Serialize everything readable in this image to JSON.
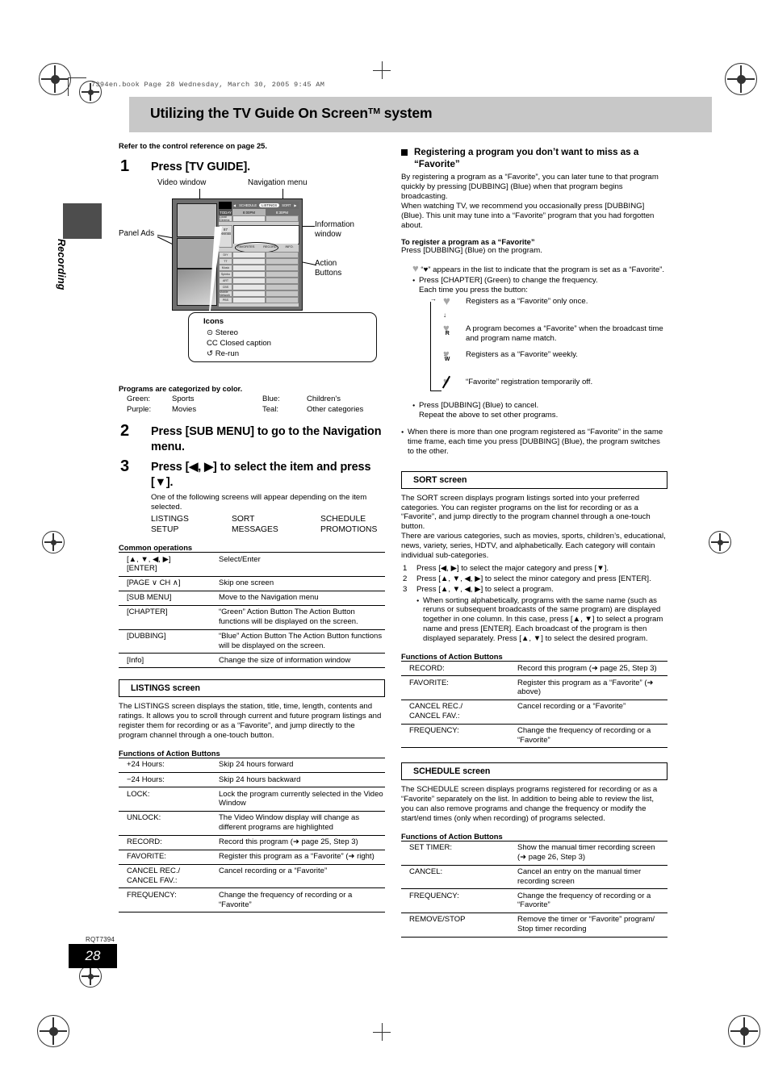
{
  "meta": {
    "running_head": "7394en.book  Page 28  Wednesday, March 30, 2005  9:45 AM",
    "side_tab": "Recording",
    "doc_code": "RQT7394",
    "page_number": "28"
  },
  "title": {
    "main": "Utilizing the TV Guide On Screen",
    "sup": "TM",
    "tail": " system"
  },
  "left": {
    "intro": "Refer to the control reference on page 25.",
    "step1": {
      "num": "1",
      "head": "Press [TV GUIDE]."
    },
    "diagram": {
      "label_video_window": "Video window",
      "label_navigation_menu": "Navigation menu",
      "label_panel_ads": "Panel Ads",
      "label_information_window": "Information\nwindow",
      "label_action_buttons": "Action\nButtons",
      "nav": {
        "left_arrow": "◀",
        "schedule": "SCHEDULE",
        "listings": "LISTINGS",
        "sort": "SORT",
        "right_arrow": "▶"
      },
      "time_header": {
        "channel": "TODAY",
        "slot1": "8:00PM",
        "slot2": "8:30PM"
      },
      "channel_cell": {
        "number": "87",
        "name": "NWSB"
      },
      "action_bar": [
        "FAVORITES",
        "RECORD",
        "INFO."
      ],
      "rows": [
        "Local Cinema",
        "DIY",
        "TT",
        "Music",
        "Spinbo",
        "ART",
        "CBS",
        "Mobile Network",
        "PBS"
      ],
      "icons_title": "Icons",
      "icons": [
        {
          "glyph": "⊙",
          "label": "Stereo"
        },
        {
          "glyph": "CC",
          "label": "Closed caption"
        },
        {
          "glyph": "↺",
          "label": "Re-run"
        }
      ]
    },
    "color_note": "Programs are categorized by color.",
    "color_table": [
      {
        "color": "Green:",
        "category": "Sports",
        "color2": "Blue:",
        "category2": "Children's"
      },
      {
        "color": "Purple:",
        "category": "Movies",
        "color2": "Teal:",
        "category2": "Other categories"
      }
    ],
    "step2": {
      "num": "2",
      "head": "Press [SUB MENU] to go to the Navigation menu."
    },
    "step3": {
      "num": "3",
      "head": "Press [◀, ▶] to select the item and press [▼].",
      "sub": "One of the following screens will appear depending on the item selected.",
      "screens": [
        "LISTINGS",
        "SORT",
        "SCHEDULE",
        "SETUP",
        "MESSAGES",
        "PROMOTIONS"
      ]
    },
    "common_ops_title": "Common operations",
    "common_ops": [
      {
        "key": "[▲, ▼, ◀, ▶]\n[ENTER]",
        "desc": "Select/Enter"
      },
      {
        "key": "[PAGE ∨ CH ∧]",
        "desc": "Skip one screen"
      },
      {
        "key": "[SUB MENU]",
        "desc": "Move to the Navigation menu"
      },
      {
        "key": "[CHAPTER]",
        "desc": "“Green” Action Button\nThe Action Button functions will be displayed on the screen."
      },
      {
        "key": "[DUBBING]",
        "desc": "“Blue” Action Button\nThe Action Button functions will be displayed on the screen."
      },
      {
        "key": "[Info]",
        "desc": "Change the size of information window"
      }
    ],
    "listings": {
      "title": "LISTINGS screen",
      "body": "The LISTINGS screen displays the station, title, time, length, contents and ratings. It allows you to scroll through current and future program listings and register them for recording or as a “Favorite”, and jump directly to the program channel through a one-touch button.",
      "functions_title": "Functions of Action Buttons",
      "functions": [
        {
          "key": "+24 Hours:",
          "desc": "Skip 24 hours forward"
        },
        {
          "key": "−24 Hours:",
          "desc": "Skip 24 hours backward"
        },
        {
          "key": "LOCK:",
          "desc": "Lock the program currently selected in the Video Window"
        },
        {
          "key": "UNLOCK:",
          "desc": "The Video Window display will change as different programs are highlighted"
        },
        {
          "key": "RECORD:",
          "desc": "Record this program (➜ page 25, Step 3)"
        },
        {
          "key": "FAVORITE:",
          "desc": "Register this program as a “Favorite” (➜ right)"
        },
        {
          "key": "CANCEL REC./\nCANCEL FAV.:",
          "desc": "Cancel recording or a “Favorite”"
        },
        {
          "key": "FREQUENCY:",
          "desc": "Change the frequency of recording or a “Favorite”"
        }
      ]
    }
  },
  "right": {
    "favorite": {
      "heading": "Registering a program you don’t want to miss as a “Favorite”",
      "body1": "By registering a program as a “Favorite”, you can later tune to that program quickly by pressing [DUBBING] (Blue) when that program begins broadcasting.",
      "body2": "When watching TV, we recommend you occasionally press [DUBBING] (Blue). This unit may tune into a “Favorite” program that you had forgotten about.",
      "subhead": "To register a program as a “Favorite”",
      "subbody": "Press [DUBBING] (Blue) on the program.",
      "note_heart": "“♥” appears in the list to indicate that the program is set as a “Favorite”.",
      "bullet_chapter": "Press [CHAPTER] (Green) to change the frequency.",
      "each_time": "Each time you press the button:",
      "frequency_steps": [
        {
          "badge": "",
          "desc": "Registers as a “Favorite” only once."
        },
        {
          "badge": "R",
          "desc": "A program becomes a “Favorite” when the broadcast time and program name match."
        },
        {
          "badge": "W",
          "desc": "Registers as a “Favorite” weekly."
        },
        {
          "badge": "/",
          "desc": "“Favorite” registration temporarily off."
        }
      ],
      "bullet_cancel": "Press [DUBBING] (Blue) to cancel.",
      "repeat": "Repeat the above to set other programs.",
      "bullet_more": "When there is more than one program registered as “Favorite” in the same time frame, each time you press [DUBBING] (Blue), the program switches to the other."
    },
    "sort": {
      "title": "SORT screen",
      "body1": "The SORT screen displays program listings sorted into your preferred categories. You can register programs on the list for recording or as a “Favorite”, and jump directly to the program channel through a one-touch button.",
      "body2": "There are various categories, such as movies, sports, children’s, educational, news, variety, series, HDTV, and alphabetically. Each category will contain individual sub-categories.",
      "steps": [
        {
          "ix": "1",
          "text": "Press [◀, ▶] to select the major category and press [▼]."
        },
        {
          "ix": "2",
          "text": "Press [▲, ▼, ◀, ▶] to select the minor category and press [ENTER]."
        },
        {
          "ix": "3",
          "text": "Press [▲, ▼, ◀, ▶] to select a program."
        }
      ],
      "bullet": "When sorting alphabetically, programs with the same name (such as reruns or subsequent broadcasts of the same program) are displayed together in one column. In this case, press [▲, ▼] to select a program name and press [ENTER]. Each broadcast of the program is then displayed separately. Press [▲, ▼] to select the desired program.",
      "functions_title": "Functions of Action Buttons",
      "functions": [
        {
          "key": "RECORD:",
          "desc": "Record this program (➜ page 25, Step 3)"
        },
        {
          "key": "FAVORITE:",
          "desc": "Register this program as a “Favorite” (➜ above)"
        },
        {
          "key": "CANCEL REC./\nCANCEL FAV.:",
          "desc": "Cancel recording or a “Favorite”"
        },
        {
          "key": "FREQUENCY:",
          "desc": "Change the frequency of recording or a “Favorite”"
        }
      ]
    },
    "schedule": {
      "title": "SCHEDULE screen",
      "body": "The SCHEDULE screen displays programs registered for recording or as a “Favorite” separately on the list. In addition to being able to review the list, you can also remove programs and change the frequency or modify the start/end times (only when recording) of programs selected.",
      "functions_title": "Functions of Action Buttons",
      "functions": [
        {
          "key": "SET TIMER:",
          "desc": "Show the manual timer recording screen (➜ page 26, Step 3)"
        },
        {
          "key": "CANCEL:",
          "desc": "Cancel an entry on the manual timer recording screen"
        },
        {
          "key": "FREQUENCY:",
          "desc": "Change the frequency of recording or a “Favorite”"
        },
        {
          "key": "REMOVE/STOP",
          "desc": "Remove the timer or “Favorite” program/ Stop timer recording"
        }
      ]
    }
  }
}
